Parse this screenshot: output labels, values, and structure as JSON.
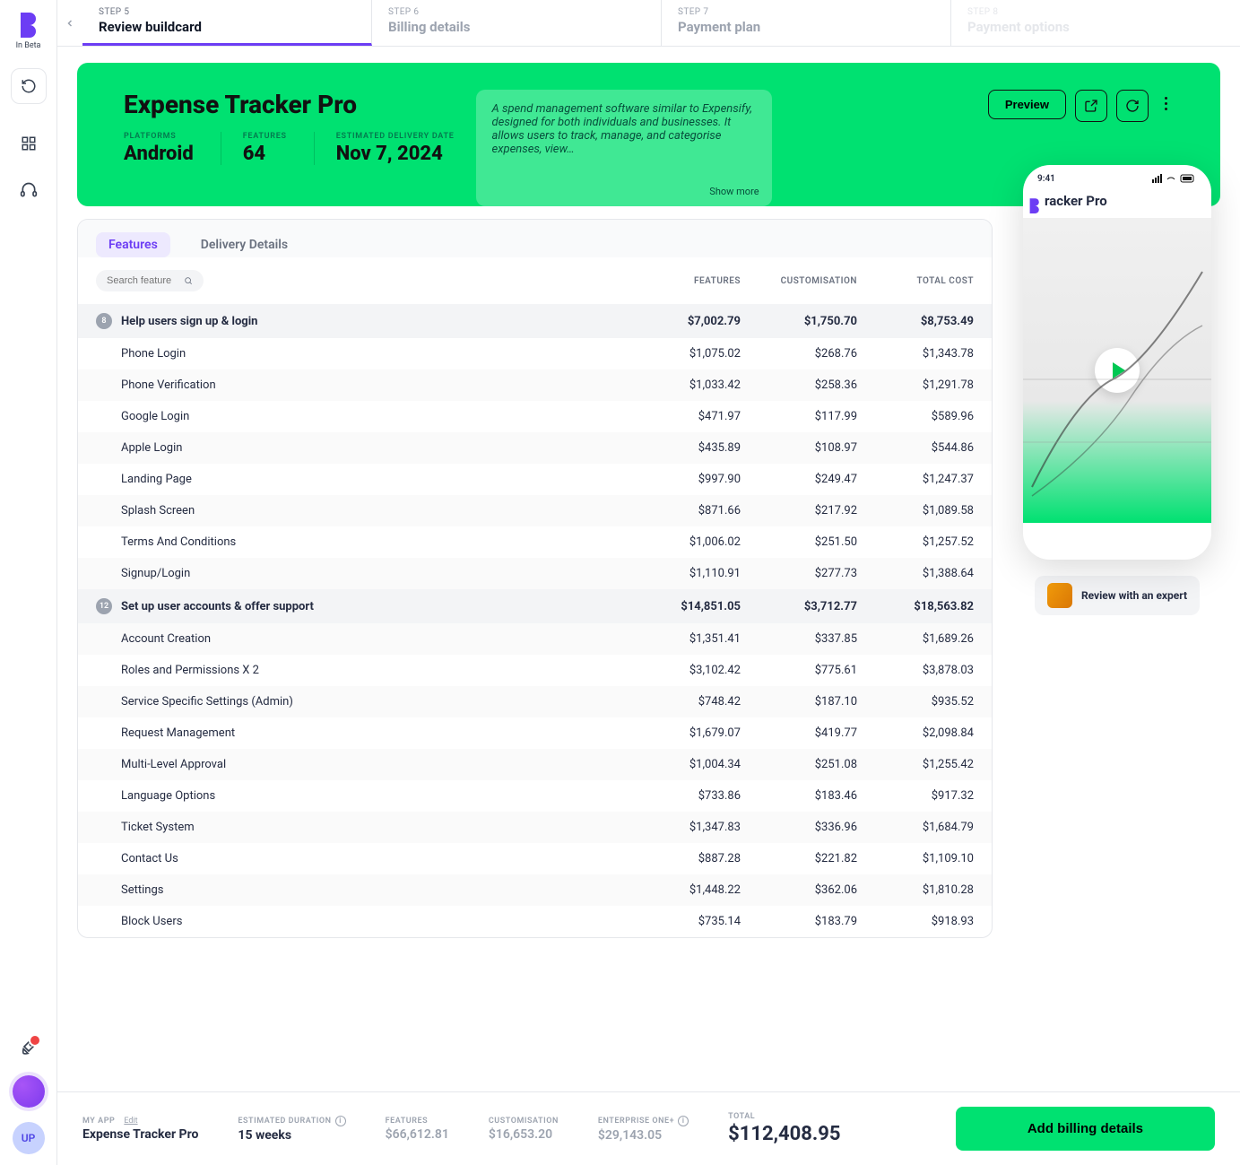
{
  "sidebar": {
    "beta_label": "In Beta",
    "avatar_initials": "UP"
  },
  "stepper": {
    "step5_num": "STEP 5",
    "step5_title": "Review buildcard",
    "step6_num": "STEP 6",
    "step6_title": "Billing details",
    "step7_num": "STEP 7",
    "step7_title": "Payment plan",
    "step8_num": "STEP 8",
    "step8_title": "Payment options"
  },
  "hero": {
    "title": "Expense Tracker Pro",
    "platforms_label": "PLATFORMS",
    "platforms_value": "Android",
    "features_label": "FEATURES",
    "features_value": "64",
    "delivery_label": "ESTIMATED DELIVERY DATE",
    "delivery_value": "Nov 7, 2024",
    "desc": "A spend management software similar to Expensify, designed for both individuals and businesses. It allows users to track, manage, and categorise expenses, view…",
    "show_more": "Show more",
    "preview_label": "Preview"
  },
  "tabs": {
    "features": "Features",
    "delivery": "Delivery Details"
  },
  "table": {
    "search_placeholder": "Search feature",
    "col_features": "FEATURES",
    "col_custom": "CUSTOMISATION",
    "col_total": "TOTAL COST",
    "groups": [
      {
        "count": "8",
        "name": "Help users sign up & login",
        "features": "$7,002.79",
        "custom": "$1,750.70",
        "total": "$8,753.49",
        "rows": [
          {
            "name": "Phone Login",
            "features": "$1,075.02",
            "custom": "$268.76",
            "total": "$1,343.78"
          },
          {
            "name": "Phone Verification",
            "features": "$1,033.42",
            "custom": "$258.36",
            "total": "$1,291.78"
          },
          {
            "name": "Google Login",
            "features": "$471.97",
            "custom": "$117.99",
            "total": "$589.96"
          },
          {
            "name": "Apple Login",
            "features": "$435.89",
            "custom": "$108.97",
            "total": "$544.86"
          },
          {
            "name": "Landing Page",
            "features": "$997.90",
            "custom": "$249.47",
            "total": "$1,247.37"
          },
          {
            "name": "Splash Screen",
            "features": "$871.66",
            "custom": "$217.92",
            "total": "$1,089.58"
          },
          {
            "name": "Terms And Conditions",
            "features": "$1,006.02",
            "custom": "$251.50",
            "total": "$1,257.52"
          },
          {
            "name": "Signup/Login",
            "features": "$1,110.91",
            "custom": "$277.73",
            "total": "$1,388.64"
          }
        ]
      },
      {
        "count": "12",
        "name": "Set up user accounts & offer support",
        "features": "$14,851.05",
        "custom": "$3,712.77",
        "total": "$18,563.82",
        "rows": [
          {
            "name": "Account Creation",
            "features": "$1,351.41",
            "custom": "$337.85",
            "total": "$1,689.26"
          },
          {
            "name": "Roles and Permissions X 2",
            "features": "$3,102.42",
            "custom": "$775.61",
            "total": "$3,878.03"
          },
          {
            "name": "Service Specific Settings (Admin)",
            "features": "$748.42",
            "custom": "$187.10",
            "total": "$935.52"
          },
          {
            "name": "Request Management",
            "features": "$1,679.07",
            "custom": "$419.77",
            "total": "$2,098.84"
          },
          {
            "name": "Multi-Level Approval",
            "features": "$1,004.34",
            "custom": "$251.08",
            "total": "$1,255.42"
          },
          {
            "name": "Language Options",
            "features": "$733.86",
            "custom": "$183.46",
            "total": "$917.32"
          },
          {
            "name": "Ticket System",
            "features": "$1,347.83",
            "custom": "$336.96",
            "total": "$1,684.79"
          },
          {
            "name": "Contact Us",
            "features": "$887.28",
            "custom": "$221.82",
            "total": "$1,109.10"
          },
          {
            "name": "Settings",
            "features": "$1,448.22",
            "custom": "$362.06",
            "total": "$1,810.28"
          },
          {
            "name": "Block Users",
            "features": "$735.14",
            "custom": "$183.79",
            "total": "$918.93"
          }
        ]
      }
    ]
  },
  "aside": {
    "phone_time": "9:41",
    "phone_title": "racker Pro",
    "expert_label": "Review with an expert"
  },
  "footer": {
    "myapp_label": "MY APP",
    "edit_label": "Edit",
    "myapp_value": "Expense Tracker Pro",
    "duration_label": "ESTIMATED DURATION",
    "duration_value": "15 weeks",
    "features_label": "FEATURES",
    "features_value": "$66,612.81",
    "custom_label": "CUSTOMISATION",
    "custom_value": "$16,653.20",
    "enterprise_label": "ENTERPRISE ONE+",
    "enterprise_value": "$29,143.05",
    "total_label": "TOTAL",
    "total_value": "$112,408.95",
    "cta_label": "Add billing details"
  }
}
